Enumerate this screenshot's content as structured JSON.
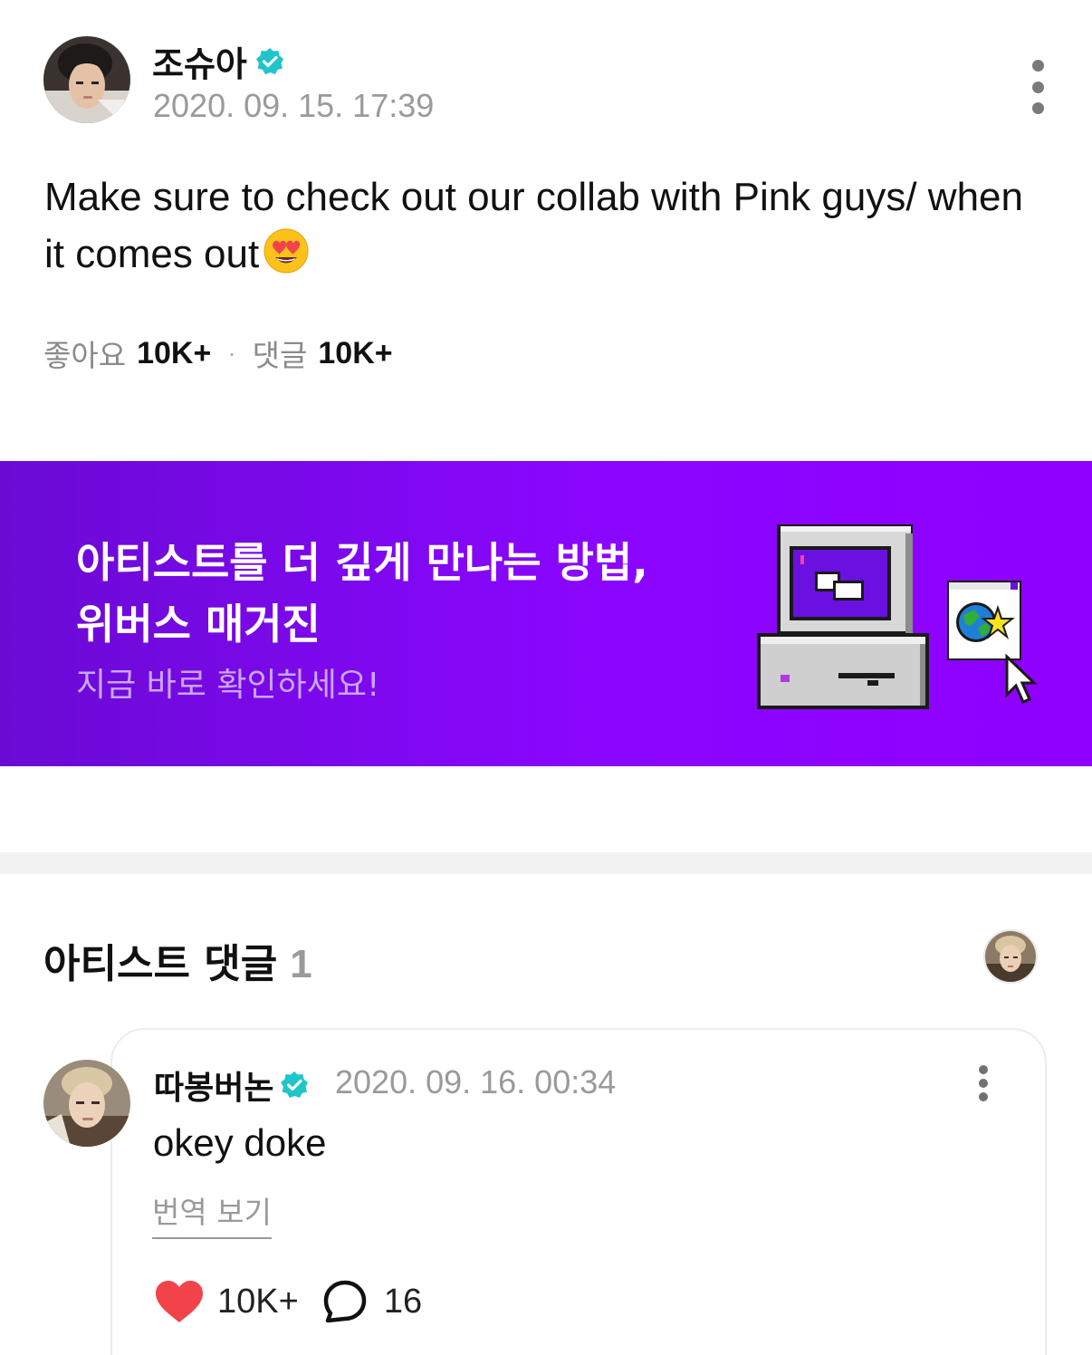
{
  "post": {
    "author": "조슈아",
    "timestamp": "2020. 09. 15. 17:39",
    "body": "Make sure to check out our collab with Pink guys/ when it comes out",
    "emoji": "smiling-face-with-heart-eyes",
    "likes_label": "좋아요",
    "likes_value": "10K+",
    "separator": "·",
    "comments_label": "댓글",
    "comments_value": "10K+"
  },
  "banner": {
    "title": "아티스트를 더 깊게 만나는 방법,\n위버스 매거진",
    "subtitle": "지금 바로 확인하세요!",
    "colors": {
      "start": "#6a0bd4",
      "end": "#8f00ff"
    }
  },
  "artist_comments": {
    "title": "아티스트 댓글",
    "count": "1"
  },
  "comment": {
    "author": "따봉버논",
    "timestamp": "2020. 09. 16. 00:34",
    "text": "okey doke",
    "translate_label": "번역 보기",
    "likes": "10K+",
    "replies": "16"
  },
  "colors": {
    "verified": "#1fc5c9",
    "like_heart": "#f2434a",
    "muted_text": "#9a9a9a"
  }
}
